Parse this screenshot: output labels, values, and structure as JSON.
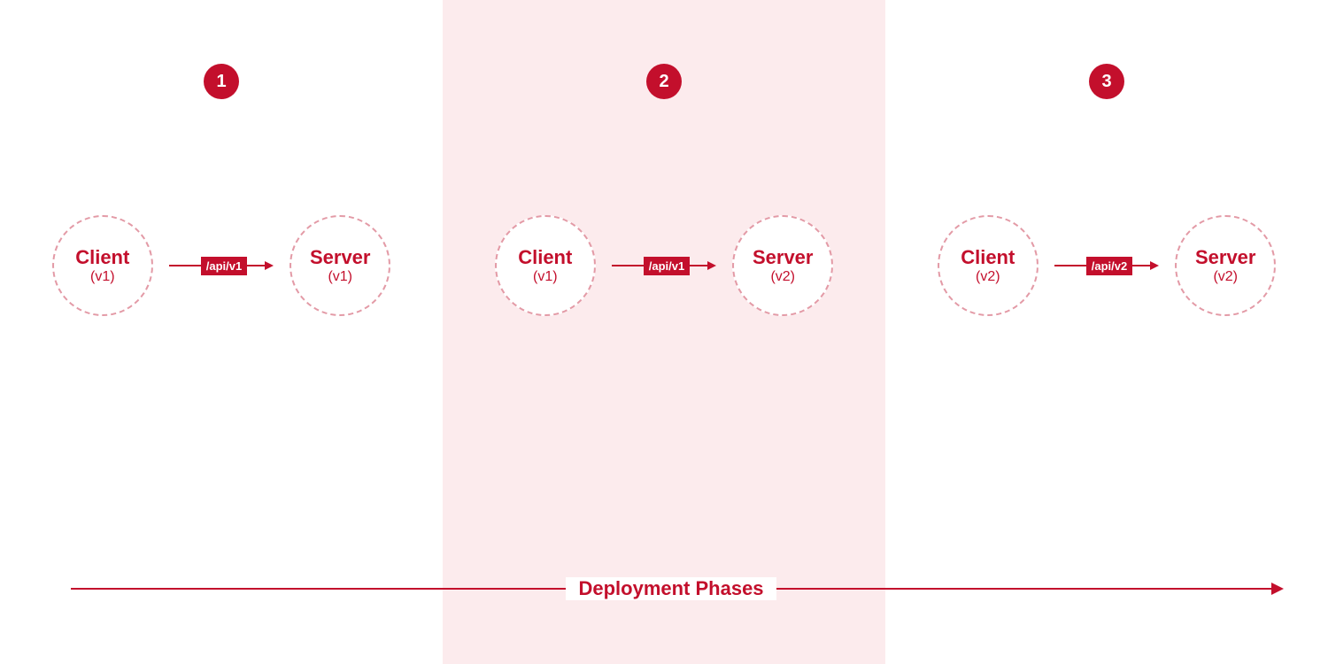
{
  "colors": {
    "accent": "#c30f2c",
    "highlight_bg": "#fcebed",
    "node_stroke": "#e39aa6"
  },
  "caption": "Deployment Phases",
  "node_labels": {
    "client": "Client",
    "server": "Server"
  },
  "phases": [
    {
      "num": "1",
      "highlight": false,
      "client_version": "(v1)",
      "server_version": "(v1)",
      "api": "/api/v1"
    },
    {
      "num": "2",
      "highlight": true,
      "client_version": "(v1)",
      "server_version": "(v2)",
      "api": "/api/v1"
    },
    {
      "num": "3",
      "highlight": false,
      "client_version": "(v2)",
      "server_version": "(v2)",
      "api": "/api/v2"
    }
  ]
}
